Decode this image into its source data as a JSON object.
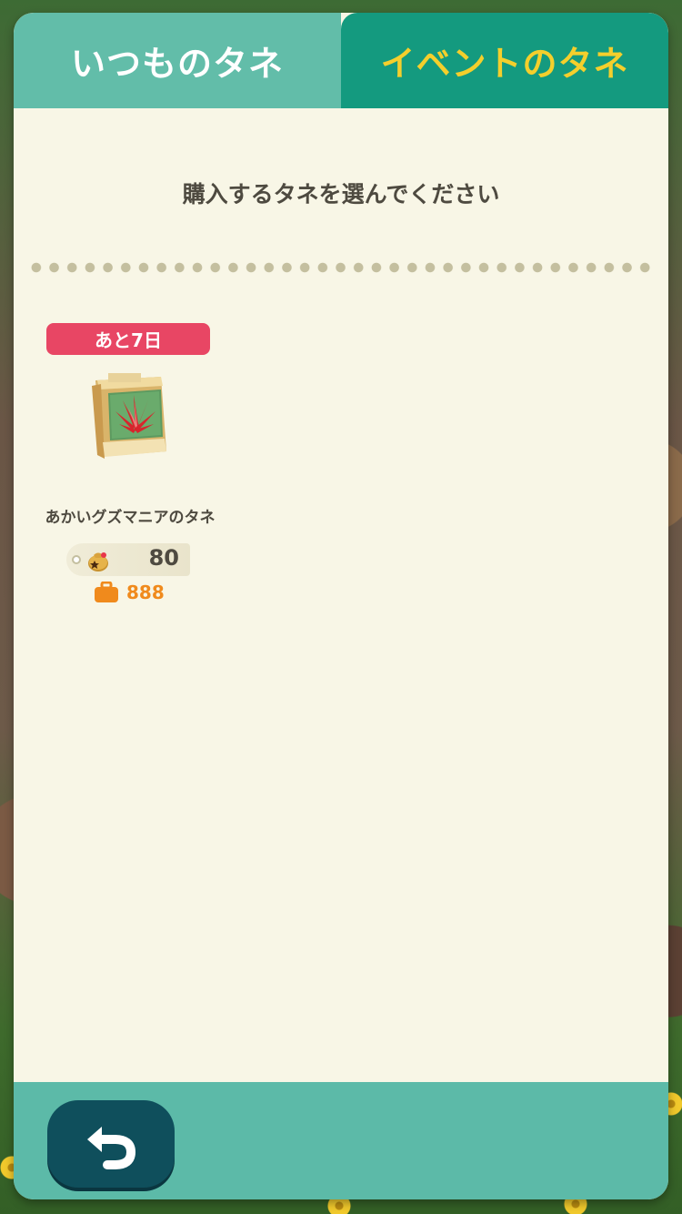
{
  "tabs": {
    "regular": "いつものタネ",
    "event": "イベントのタネ",
    "active": "event"
  },
  "instruction": "購入するタネを選んでください",
  "items": [
    {
      "days_left": "あと7日",
      "name": "あかいグズマニアのタネ",
      "price": "80",
      "owned": "888",
      "icon": "red-guzmania-seed-bag-icon"
    }
  ],
  "footer": {
    "back_icon": "back-arrow-icon"
  },
  "colors": {
    "tab_regular": "#62bda9",
    "tab_event": "#149a7f",
    "tab_event_text": "#f4cf2c",
    "badge": "#e84664",
    "owned": "#f08a1c",
    "footer": "#5cbaa8",
    "back_button": "#0f4f5c"
  }
}
